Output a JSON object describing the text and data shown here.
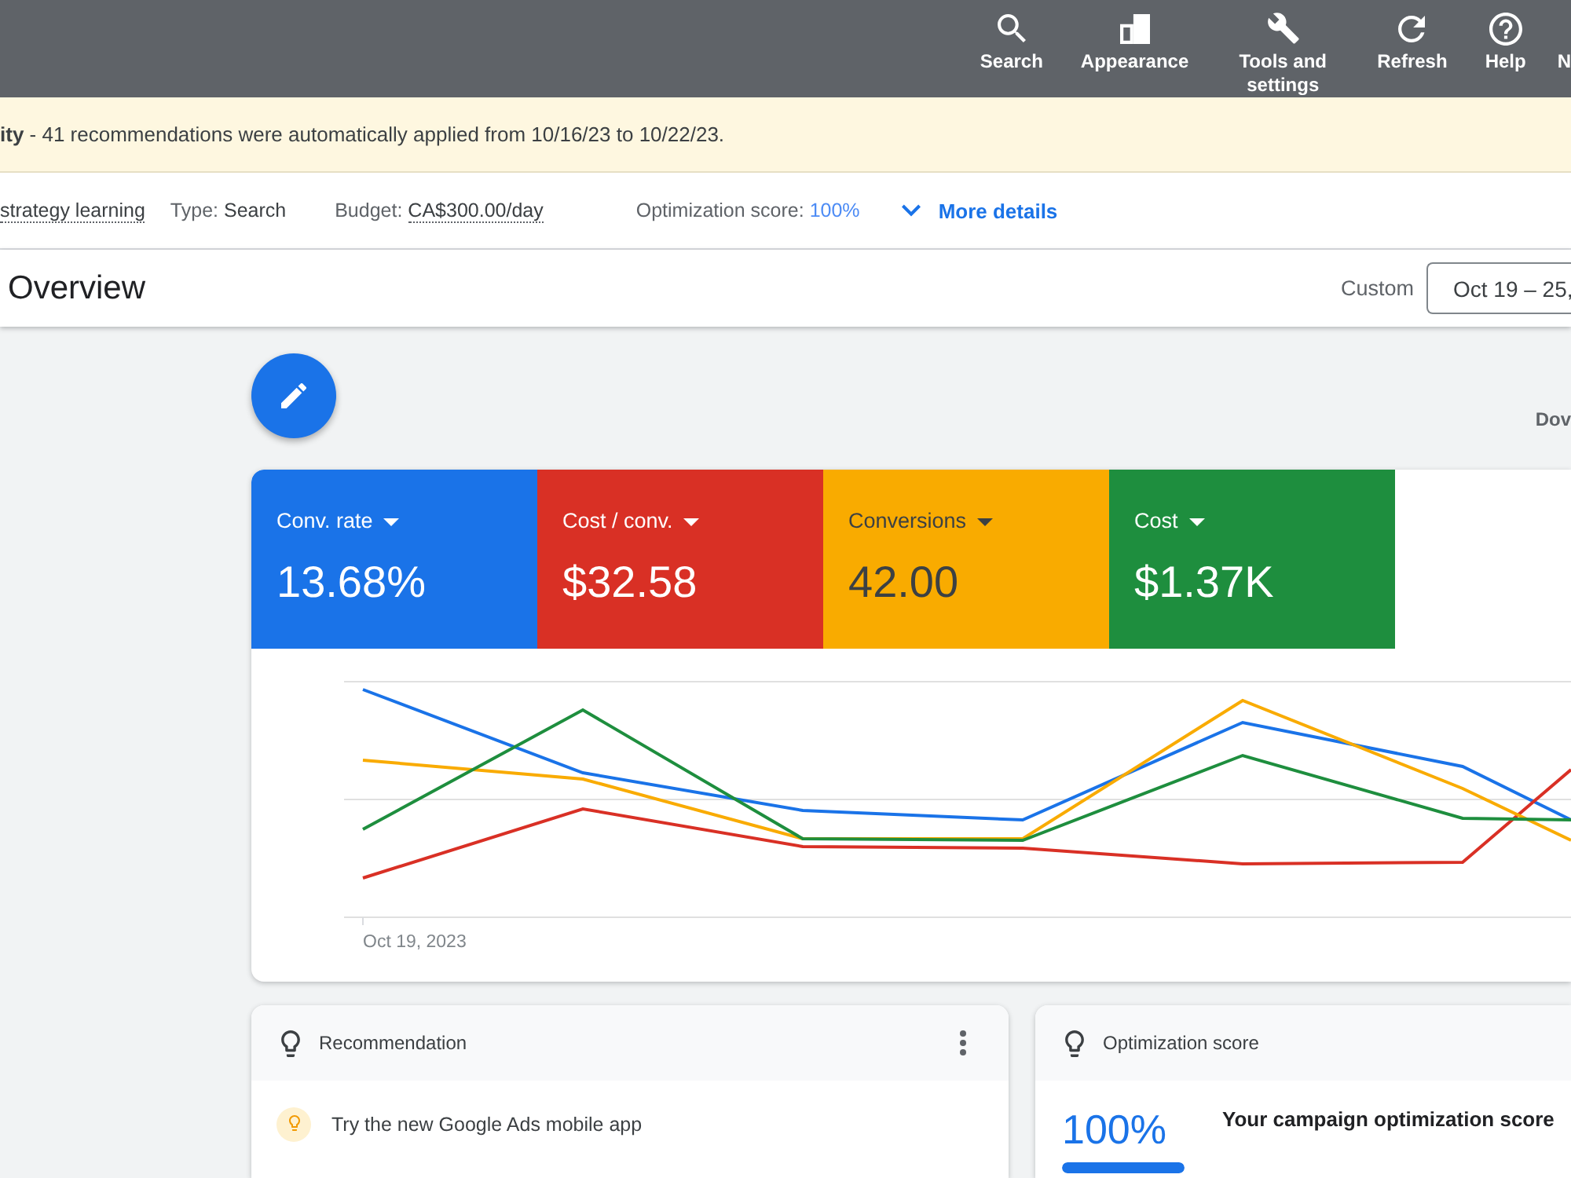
{
  "top_bar": {
    "items": [
      {
        "label": "Search"
      },
      {
        "label": "Appearance"
      },
      {
        "label": "Tools and settings"
      },
      {
        "label": "Refresh"
      },
      {
        "label": "Help"
      },
      {
        "label": "N"
      }
    ]
  },
  "banner": {
    "text": "**ity** - 41 recommendations were automatically applied from 10/16/23 to 10/22/23."
  },
  "campaign_info": {
    "status": "strategy learning",
    "type": {
      "label": "Type:",
      "value": "Search"
    },
    "budget": {
      "label": "Budget:",
      "value": "CA$300.00/day"
    },
    "optimization_score": {
      "label": "Optimization score:",
      "value": "100%"
    },
    "more_details": "More details"
  },
  "header": {
    "title": "Overview",
    "date_label": "Custom",
    "date_range": "Oct 19 – 25,"
  },
  "download": "Dov",
  "performance_card": {
    "metrics": [
      {
        "label": "Conv. rate",
        "value": "13.68%",
        "color": "#1a73e8"
      },
      {
        "label": "Cost / conv.",
        "value": "$32.58",
        "color": "#d93025"
      },
      {
        "label": "Conversions",
        "value": "42.00",
        "color": "#f9ab00"
      },
      {
        "label": "Cost",
        "value": "$1.37K",
        "color": "#1e8e3e"
      }
    ],
    "chart": {
      "x_label": "Oct 19, 2023"
    }
  },
  "recommendation_card": {
    "title": "Recommendation",
    "item": "Try the new Google Ads mobile app"
  },
  "optimization_card": {
    "title": "Optimization score",
    "score": "100%",
    "level": 1,
    "headline": "Your campaign optimization score"
  }
}
